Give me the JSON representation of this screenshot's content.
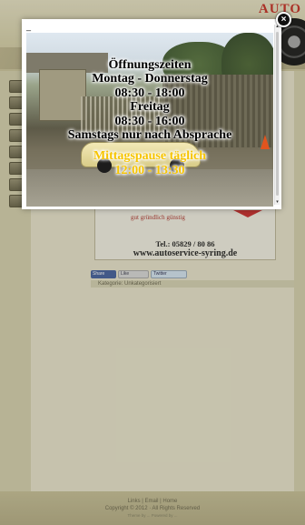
{
  "header": {
    "logo_text": "AUTO"
  },
  "background_page": {
    "flyer": {
      "tagline": "gut gründlich günstig",
      "phone": "Tel.: 05829 / 80 86",
      "website": "www.autoservice-syring.de"
    },
    "share": {
      "facebook_share": "Share",
      "facebook_like": "Like",
      "twitter": "Twitter"
    },
    "category": "Kategorie: Unkategorisiert",
    "footer": {
      "links": "Links | Email | Home",
      "copyright": "Copyright © 2012 · All Rights Reserved",
      "credit": "Theme by ... Powered by ..."
    }
  },
  "lightbox": {
    "minimize_glyph": "_",
    "close_glyph": "×",
    "hours": {
      "title": "Öffnungszeiten",
      "weekday_label": "Montag - Donnerstag",
      "weekday_hours": "08:30 - 18:00",
      "friday_label": "Freitag",
      "friday_hours": "08:30 - 16:00",
      "saturday_note": "Samstags nur nach Absprache",
      "lunch_note": "Mittagspause täglich",
      "lunch_hours": "12:00 - 13:30"
    },
    "scrollbar": {
      "up_glyph": "▴",
      "down_glyph": "▾"
    }
  },
  "colors": {
    "lunch_text": "#f6c400",
    "accent_red": "#c9342a",
    "page_bg": "#d7d2b0"
  },
  "icons": [
    "close-icon",
    "minimize-icon",
    "scroll-up-icon",
    "scroll-down-icon",
    "tire-icon"
  ]
}
